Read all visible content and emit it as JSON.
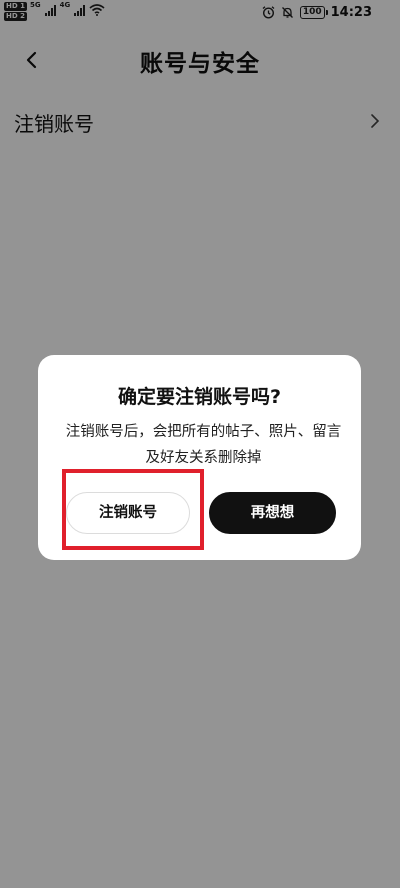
{
  "status_bar": {
    "hd_top": "HD 1",
    "hd_bottom": "HD 2",
    "net1": "5G",
    "net2": "4G",
    "battery": "100",
    "time": "14:23"
  },
  "header": {
    "title": "账号与安全"
  },
  "settings": {
    "items": [
      {
        "label": "注销账号"
      }
    ]
  },
  "dialog": {
    "title": "确定要注销账号吗?",
    "message": "注销账号后，会把所有的帖子、照片、留言及好友关系删除掉",
    "confirm_label": "注销账号",
    "reconsider_label": "再想想"
  },
  "colors": {
    "overlay": "rgba(0,0,0,0.42)",
    "primary_button": "#111111",
    "highlight": "#e0202c"
  }
}
